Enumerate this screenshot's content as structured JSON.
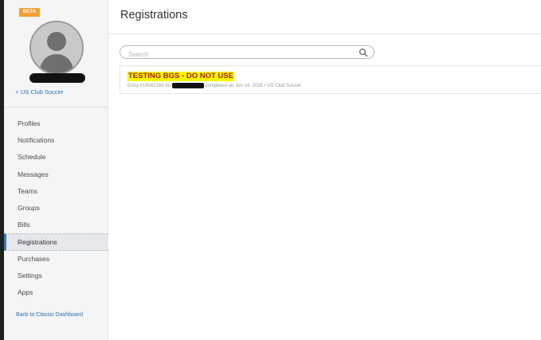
{
  "sidebar": {
    "beta_badge": "BETA",
    "back_link": "US Club Soccer",
    "nav_items": [
      {
        "label": "Profiles"
      },
      {
        "label": "Notifications"
      },
      {
        "label": "Schedule"
      },
      {
        "label": "Messages"
      },
      {
        "label": "Teams"
      },
      {
        "label": "Groups"
      },
      {
        "label": "Bills"
      },
      {
        "label": "Registrations",
        "active": true
      },
      {
        "label": "Purchases"
      },
      {
        "label": "Settings"
      },
      {
        "label": "Apps"
      }
    ],
    "classic_link": "Back to Classic Dashboard"
  },
  "main": {
    "title": "Registrations",
    "search": {
      "placeholder": "Search",
      "value": ""
    },
    "entries": [
      {
        "title": "TESTING BGS - DO NOT USE",
        "meta_prefix": "Entry #18562169 for",
        "meta_suffix": "completed on Jun 14, 2018 • US Club Soccer"
      }
    ]
  },
  "colors": {
    "accent": "#2f7fc1",
    "link": "#2a6fb0",
    "beta": "#f0a031",
    "highlight": "#f7f600",
    "entry_title": "#b11e1e"
  },
  "icons": {
    "avatar": "user-silhouette-icon",
    "back": "chevron-left-icon",
    "search": "search-icon"
  }
}
